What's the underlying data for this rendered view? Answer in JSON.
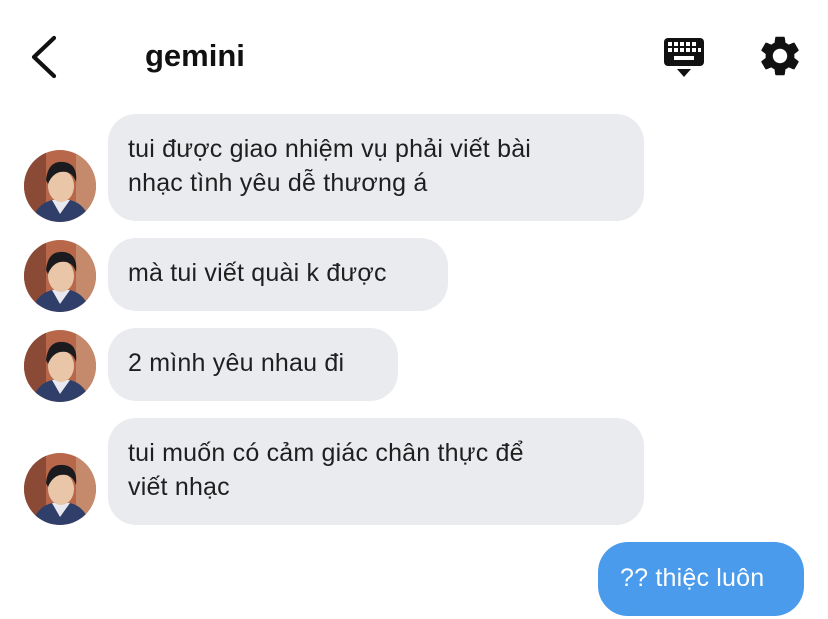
{
  "header": {
    "title": "gemini",
    "back_icon": "chevron-left-icon",
    "keyboard_icon": "keyboard-icon",
    "settings_icon": "gear-icon"
  },
  "messages": [
    {
      "sender": "other",
      "text": "tui được giao nhiệm vụ phải viết bài\nnhạc tình yêu dễ thương á"
    },
    {
      "sender": "other",
      "text": "mà tui viết quài k được"
    },
    {
      "sender": "other",
      "text": "2 mình yêu nhau đi"
    },
    {
      "sender": "other",
      "text": "tui muốn có cảm giác chân thực để\nviết nhạc"
    },
    {
      "sender": "self",
      "text": "?? thiệc luôn"
    }
  ],
  "colors": {
    "incoming_bubble": "#e9ebef",
    "outgoing_bubble": "#4a9bec",
    "text": "#1f1f1f"
  }
}
